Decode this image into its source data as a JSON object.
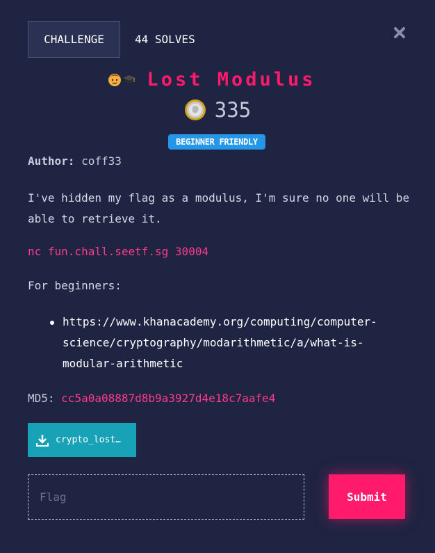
{
  "tabs": {
    "challenge_label": "CHALLENGE",
    "solves_label": "44 SOLVES"
  },
  "close_icon": "close-x-icon",
  "challenge": {
    "title": "Lost Modulus",
    "title_emoji_icon": "student-icon",
    "points_icon": "coin-icon",
    "points": "335",
    "badge": "BEGINNER FRIENDLY",
    "author_key": "Author:",
    "author_value": "coff33",
    "description": "I've hidden my flag as a modulus, I'm sure no one will be able to retrieve it.",
    "connection": "nc fun.chall.seetf.sg 30004",
    "beginners_heading": "For beginners:",
    "resources": [
      "https://www.khanacademy.org/computing/computer-science/cryptography/modarithmetic/a/what-is-modular-arithmetic"
    ],
    "md5_key": "MD5:",
    "md5_value": "cc5a0a08887d8b9a3927d4e18c7aafe4"
  },
  "download": {
    "icon": "download-icon",
    "label": "crypto_lost…"
  },
  "flag_form": {
    "placeholder": "Flag",
    "value": "",
    "submit_label": "Submit"
  },
  "colors": {
    "background": "#1e2442",
    "accent_pink": "#ff1a6b",
    "link_pink": "#ff3b8b",
    "badge_blue": "#2596e8",
    "download_teal": "#17a2b8"
  }
}
